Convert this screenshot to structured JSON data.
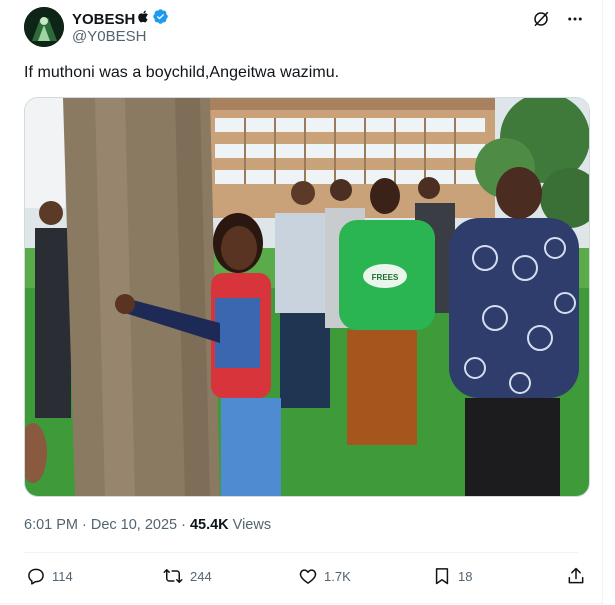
{
  "post": {
    "author": {
      "display_name": "YOBESH",
      "name_suffix_icon": "apple-icon",
      "verified_icon": "verified-badge-icon",
      "handle": "@Y0BESH"
    },
    "text": "If muthoni was a boychild,Angeitwa wazimu.",
    "media": {
      "shirt_text": "FREES"
    },
    "meta": {
      "time": "6:01 PM",
      "separator": "·",
      "date": "Dec 10, 2025",
      "views_count": "45.4K",
      "views_label": "Views"
    },
    "actions": {
      "replies": "114",
      "reposts": "244",
      "likes": "1.7K",
      "bookmarks": "18"
    }
  },
  "colors": {
    "accent": "#1d9bf0",
    "text": "#0f1419",
    "secondary": "#536471",
    "border": "#cfd9de"
  }
}
